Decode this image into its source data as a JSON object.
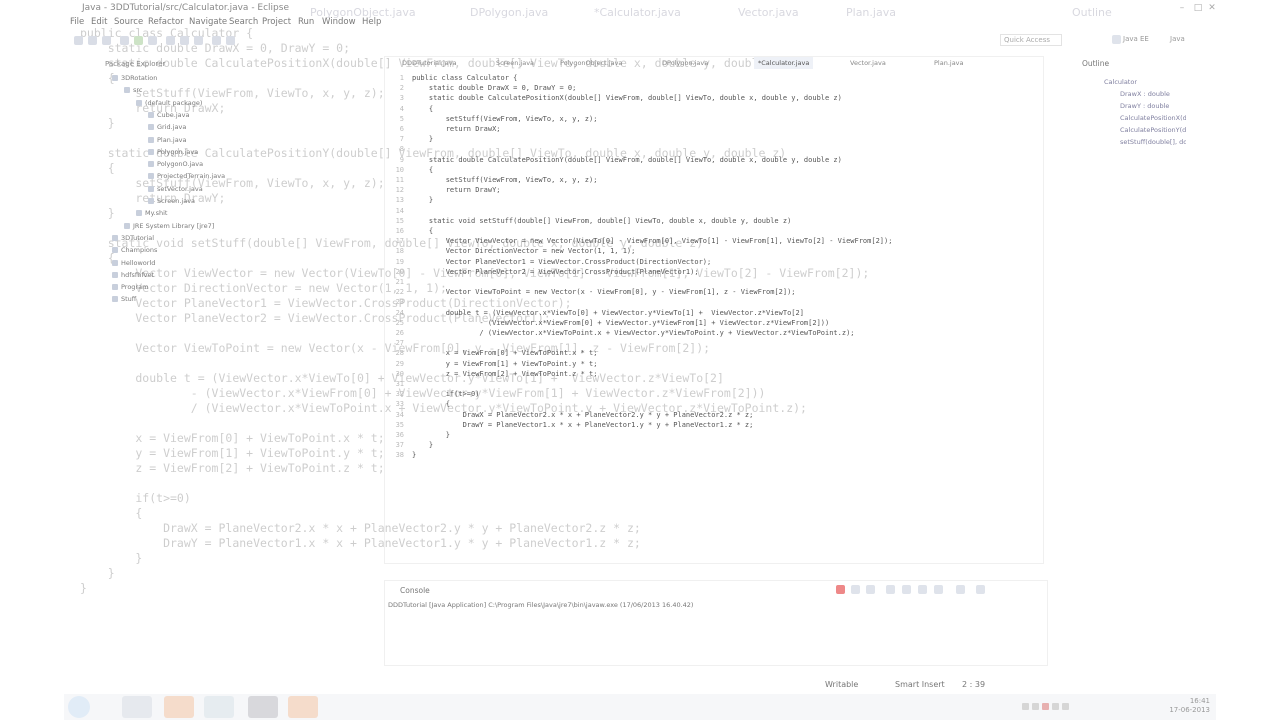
{
  "window": {
    "title": "Java - 3DDTutorial/src/Calculator.java - Eclipse"
  },
  "menu": [
    "File",
    "Edit",
    "Source",
    "Refactor",
    "Navigate",
    "Search",
    "Project",
    "Run",
    "Window",
    "Help"
  ],
  "top_tabs": [
    "Screen.java",
    "PolygonObject.java",
    "DPolygon.java",
    "*Calculator.java",
    "Vector.java",
    "Plan.java",
    "Outline"
  ],
  "quick_access": "Quick Access",
  "perspectives": [
    "Java EE",
    "Java"
  ],
  "package_explorer": {
    "tab": "Package Explorer",
    "items": [
      {
        "label": "3DRotation",
        "indent": 0
      },
      {
        "label": "src",
        "indent": 1
      },
      {
        "label": "(default package)",
        "indent": 2
      },
      {
        "label": "Cube.java",
        "indent": 3
      },
      {
        "label": "Grid.java",
        "indent": 3
      },
      {
        "label": "Plan.java",
        "indent": 3
      },
      {
        "label": "Polygon.java",
        "indent": 3
      },
      {
        "label": "PolygonO.java",
        "indent": 3
      },
      {
        "label": "ProjectedTerrain.java",
        "indent": 3
      },
      {
        "label": "setVector.java",
        "indent": 3
      },
      {
        "label": "Screen.java",
        "indent": 3
      },
      {
        "label": "My.shit",
        "indent": 2
      },
      {
        "label": "JRE System Library [jre7]",
        "indent": 1
      },
      {
        "label": "3DTutorial",
        "indent": 0
      },
      {
        "label": "Champions",
        "indent": 0
      },
      {
        "label": "Helloworld",
        "indent": 0
      },
      {
        "label": "hdfsfhfvet",
        "indent": 0
      },
      {
        "label": "Program",
        "indent": 0
      },
      {
        "label": "Stuff",
        "indent": 0
      }
    ]
  },
  "editor": {
    "tabs": [
      {
        "label": "DDDTutorial.java",
        "active": false
      },
      {
        "label": "Screen.java",
        "active": false
      },
      {
        "label": "PolygonObject.java",
        "active": false
      },
      {
        "label": "DPolygon.java",
        "active": false
      },
      {
        "label": "*Calculator.java",
        "active": true
      },
      {
        "label": "Vector.java",
        "active": false
      },
      {
        "label": "Plan.java",
        "active": false
      }
    ],
    "lines": [
      {
        "n": "1",
        "t": "public class Calculator {"
      },
      {
        "n": "2",
        "t": "    static double DrawX = 0, DrawY = 0;"
      },
      {
        "n": "3",
        "t": "    static double CalculatePositionX(double[] ViewFrom, double[] ViewTo, double x, double y, double z)"
      },
      {
        "n": "4",
        "t": "    {"
      },
      {
        "n": "5",
        "t": "        setStuff(ViewFrom, ViewTo, x, y, z);"
      },
      {
        "n": "6",
        "t": "        return DrawX;"
      },
      {
        "n": "7",
        "t": "    }"
      },
      {
        "n": "8",
        "t": ""
      },
      {
        "n": "9",
        "t": "    static double CalculatePositionY(double[] ViewFrom, double[] ViewTo, double x, double y, double z)"
      },
      {
        "n": "10",
        "t": "    {"
      },
      {
        "n": "11",
        "t": "        setStuff(ViewFrom, ViewTo, x, y, z);"
      },
      {
        "n": "12",
        "t": "        return DrawY;"
      },
      {
        "n": "13",
        "t": "    }"
      },
      {
        "n": "14",
        "t": ""
      },
      {
        "n": "15",
        "t": "    static void setStuff(double[] ViewFrom, double[] ViewTo, double x, double y, double z)"
      },
      {
        "n": "16",
        "t": "    {"
      },
      {
        "n": "17",
        "t": "        Vector ViewVector = new Vector(ViewTo[0] - ViewFrom[0], ViewTo[1] - ViewFrom[1], ViewTo[2] - ViewFrom[2]);"
      },
      {
        "n": "18",
        "t": "        Vector DirectionVector = new Vector(1, 1, 1);"
      },
      {
        "n": "19",
        "t": "        Vector PlaneVector1 = ViewVector.CrossProduct(DirectionVector);"
      },
      {
        "n": "20",
        "t": "        Vector PlaneVector2 = ViewVector.CrossProduct(PlaneVector1);"
      },
      {
        "n": "21",
        "t": ""
      },
      {
        "n": "22",
        "t": "        Vector ViewToPoint = new Vector(x - ViewFrom[0], y - ViewFrom[1], z - ViewFrom[2]);"
      },
      {
        "n": "23",
        "t": ""
      },
      {
        "n": "24",
        "t": "        double t = (ViewVector.x*ViewTo[0] + ViewVector.y*ViewTo[1] +  ViewVector.z*ViewTo[2]"
      },
      {
        "n": "25",
        "t": "                - (ViewVector.x*ViewFrom[0] + ViewVector.y*ViewFrom[1] + ViewVector.z*ViewFrom[2]))"
      },
      {
        "n": "26",
        "t": "                / (ViewVector.x*ViewToPoint.x + ViewVector.y*ViewToPoint.y + ViewVector.z*ViewToPoint.z);"
      },
      {
        "n": "27",
        "t": ""
      },
      {
        "n": "28",
        "t": "        x = ViewFrom[0] + ViewToPoint.x * t;"
      },
      {
        "n": "29",
        "t": "        y = ViewFrom[1] + ViewToPoint.y * t;"
      },
      {
        "n": "30",
        "t": "        z = ViewFrom[2] + ViewToPoint.z * t;"
      },
      {
        "n": "31",
        "t": ""
      },
      {
        "n": "32",
        "t": "        if(t>=0)"
      },
      {
        "n": "33",
        "t": "        {"
      },
      {
        "n": "34",
        "t": "            DrawX = PlaneVector2.x * x + PlaneVector2.y * y + PlaneVector2.z * z;"
      },
      {
        "n": "35",
        "t": "            DrawY = PlaneVector1.x * x + PlaneVector1.y * y + PlaneVector1.z * z;"
      },
      {
        "n": "36",
        "t": "        }"
      },
      {
        "n": "37",
        "t": "    }"
      },
      {
        "n": "38",
        "t": "}"
      }
    ]
  },
  "console": {
    "tab": "Console",
    "text": "DDDTutorial [Java Application] C:\\Program Files\\Java\\jre7\\bin\\javaw.exe (17/06/2013 16.40.42)"
  },
  "outline": {
    "tab": "Outline",
    "items": [
      "Calculator",
      "DrawX : double",
      "DrawY : double",
      "CalculatePositionX(double[], double[], double, double, double) : double",
      "CalculatePositionY(double[], double[], double, double, double) : double",
      "setStuff(double[], double[], double, double, double) : void"
    ]
  },
  "status": {
    "writable": "Writable",
    "insert_mode": "Smart Insert",
    "position": "2 : 39"
  },
  "taskbar": {
    "time": "16:41",
    "date": "17-06-2013"
  }
}
